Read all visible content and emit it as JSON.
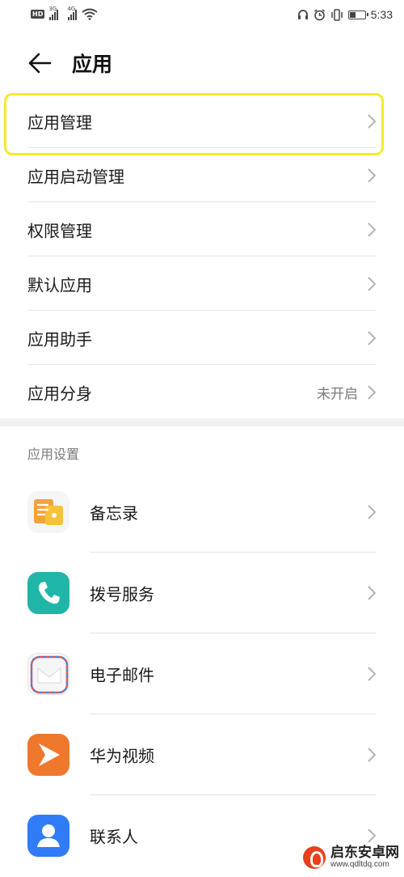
{
  "status_bar": {
    "hd": "HD",
    "sim1_tag": "3G",
    "sim2_tag": "4G",
    "time": "5:33",
    "battery_level": 0.45,
    "icons": [
      "headset-icon",
      "alarm-icon",
      "vibrate-icon",
      "battery-icon",
      "wifi-icon"
    ]
  },
  "header": {
    "title": "应用",
    "back_icon": "arrow-left-icon"
  },
  "menu": [
    {
      "label": "应用管理",
      "value": "",
      "highlighted": true
    },
    {
      "label": "应用启动管理",
      "value": ""
    },
    {
      "label": "权限管理",
      "value": ""
    },
    {
      "label": "默认应用",
      "value": ""
    },
    {
      "label": "应用助手",
      "value": ""
    },
    {
      "label": "应用分身",
      "value": "未开启"
    }
  ],
  "section": {
    "title": "应用设置"
  },
  "apps": [
    {
      "label": "备忘录",
      "icon": "memo-icon"
    },
    {
      "label": "拨号服务",
      "icon": "phone-icon"
    },
    {
      "label": "电子邮件",
      "icon": "mail-icon"
    },
    {
      "label": "华为视频",
      "icon": "video-icon"
    },
    {
      "label": "联系人",
      "icon": "contacts-icon"
    }
  ],
  "watermark": {
    "name": "启东安卓网",
    "url": "www.qdltdq.com"
  },
  "colors": {
    "highlight": "#f4ea2a",
    "chevron": "#b3b3b3",
    "memo": "#f2a33a",
    "phone": "#1fb5a7",
    "video": "#f0782d",
    "contacts": "#2f7cf6"
  }
}
